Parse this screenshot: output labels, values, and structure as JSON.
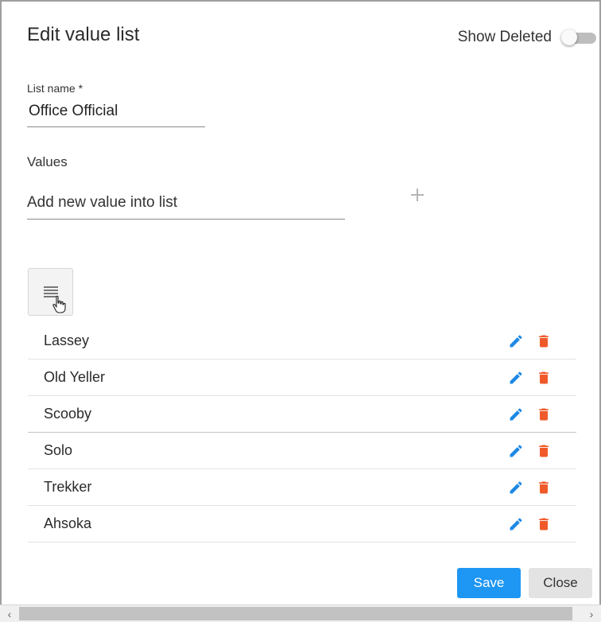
{
  "dialog": {
    "title": "Edit value list",
    "show_deleted_label": "Show Deleted",
    "show_deleted_on": false
  },
  "form": {
    "list_name_label": "List name *",
    "list_name_value": "Office Official",
    "values_label": "Values",
    "new_value_placeholder": "Add new value into list",
    "add_icon": "plus-icon",
    "sort_icon": "drag-handle-icon"
  },
  "values": [
    {
      "label": "Lassey"
    },
    {
      "label": "Old Yeller"
    },
    {
      "label": "Scooby"
    },
    {
      "label": "Solo"
    },
    {
      "label": "Trekker"
    },
    {
      "label": "Ahsoka"
    }
  ],
  "actions": {
    "save_label": "Save",
    "close_label": "Close"
  },
  "colors": {
    "primary": "#1e96f3",
    "edit_icon": "#1e88e5",
    "delete_icon": "#f05a2a"
  }
}
